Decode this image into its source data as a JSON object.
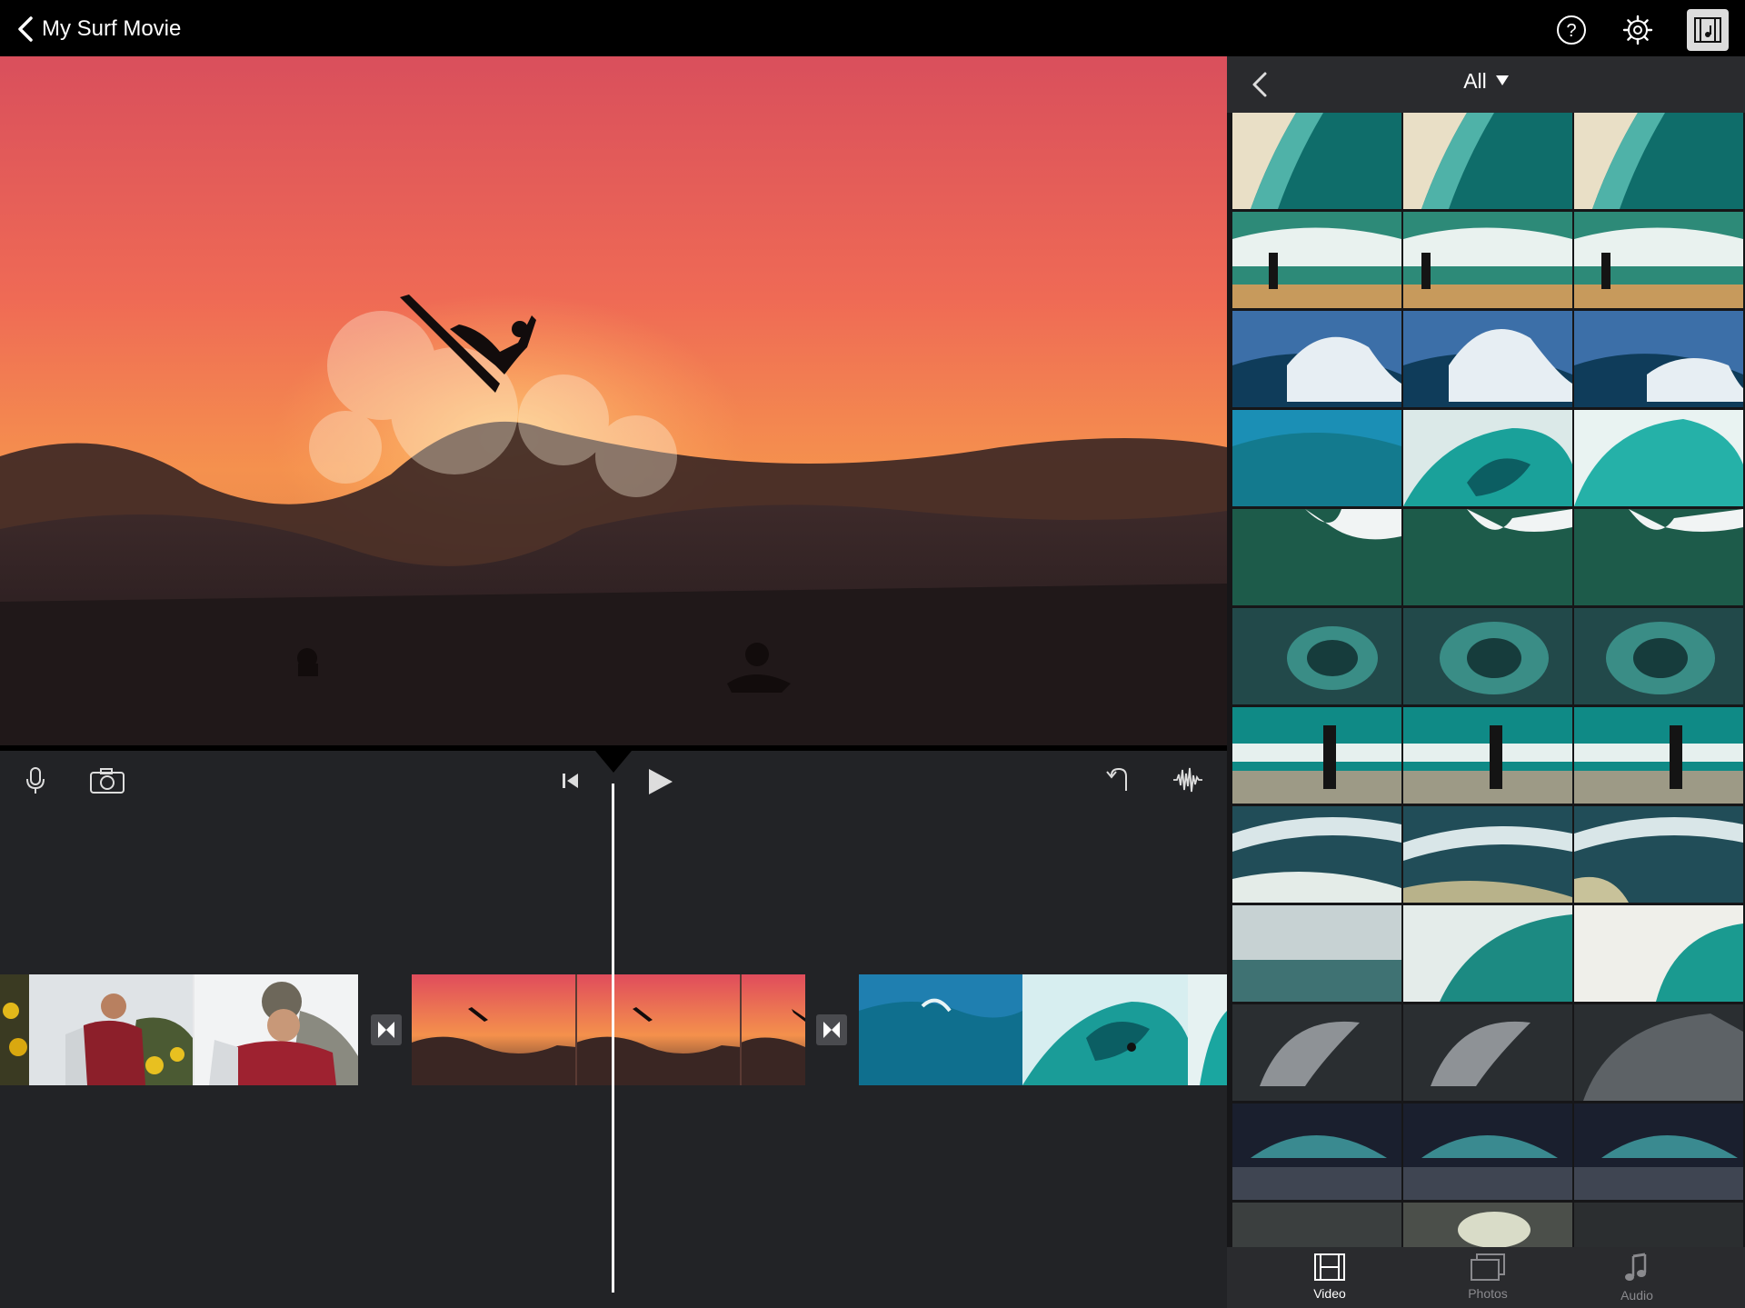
{
  "header": {
    "back_label": "My Surf Movie",
    "help_icon": "help-icon",
    "settings_icon": "gear-icon",
    "media_icon": "media-browser-icon"
  },
  "editor": {
    "tools": [
      "microphone-icon",
      "camera-icon",
      "skip-to-start-icon",
      "play-icon",
      "undo-icon",
      "audio-waveform-icon"
    ]
  },
  "browser": {
    "filter_label": "All",
    "tabs": [
      {
        "label": "Video",
        "icon": "film-icon",
        "active": true
      },
      {
        "label": "Photos",
        "icon": "photos-icon",
        "active": false
      },
      {
        "label": "Audio",
        "icon": "music-note-icon",
        "active": false
      }
    ]
  },
  "colors": {
    "background": "#222326",
    "header": "#000000",
    "accent": "#ffffff",
    "inactive_tab": "#8a8a8e"
  }
}
